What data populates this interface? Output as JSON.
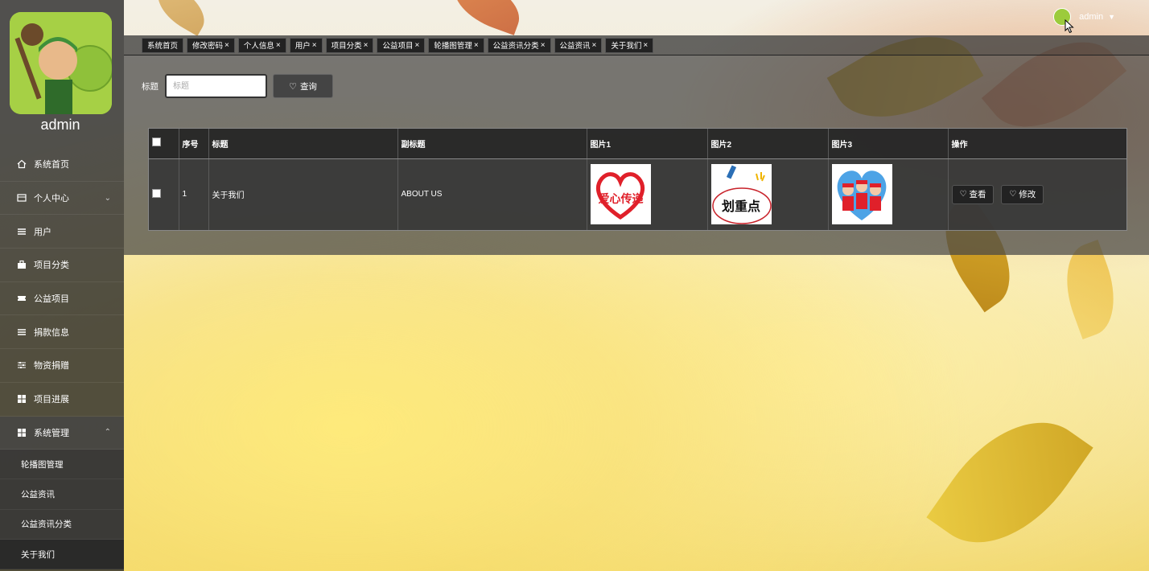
{
  "sidebar": {
    "username": "admin",
    "items": [
      {
        "label": "系统首页",
        "icon": "home-icon"
      },
      {
        "label": "个人中心",
        "icon": "id-card-icon",
        "expandable": true
      },
      {
        "label": "用户",
        "icon": "list-icon"
      },
      {
        "label": "项目分类",
        "icon": "briefcase-icon"
      },
      {
        "label": "公益项目",
        "icon": "ticket-icon"
      },
      {
        "label": "捐款信息",
        "icon": "list-icon"
      },
      {
        "label": "物资捐赠",
        "icon": "sliders-icon"
      },
      {
        "label": "项目进展",
        "icon": "grid-icon"
      },
      {
        "label": "系统管理",
        "icon": "grid-icon",
        "expanded": true
      }
    ],
    "subitems": [
      {
        "label": "轮播图管理"
      },
      {
        "label": "公益资讯"
      },
      {
        "label": "公益资讯分类"
      },
      {
        "label": "关于我们"
      }
    ]
  },
  "header": {
    "username": "admin"
  },
  "tabs": [
    {
      "label": "系统首页",
      "closable": false
    },
    {
      "label": "修改密码",
      "closable": true
    },
    {
      "label": "个人信息",
      "closable": true
    },
    {
      "label": "用户",
      "closable": true
    },
    {
      "label": "项目分类",
      "closable": true
    },
    {
      "label": "公益项目",
      "closable": true
    },
    {
      "label": "轮播图管理",
      "closable": true
    },
    {
      "label": "公益资讯分类",
      "closable": true
    },
    {
      "label": "公益资讯",
      "closable": true
    },
    {
      "label": "关于我们",
      "closable": true
    }
  ],
  "search": {
    "label": "标题",
    "placeholder": "标题",
    "button_label": "查询"
  },
  "table": {
    "headers": [
      "序号",
      "标题",
      "副标题",
      "图片1",
      "图片2",
      "图片3",
      "操作"
    ],
    "rows": [
      {
        "index": "1",
        "title": "关于我们",
        "subtitle": "ABOUT US",
        "image1_text": "爱心传递",
        "image2_text": "划重点",
        "view_label": "查看",
        "edit_label": "修改"
      }
    ]
  },
  "colors": {
    "sidebar_bg": "#2d2d2d",
    "panel_bg": "#464646",
    "accent_red": "#e0202a"
  }
}
